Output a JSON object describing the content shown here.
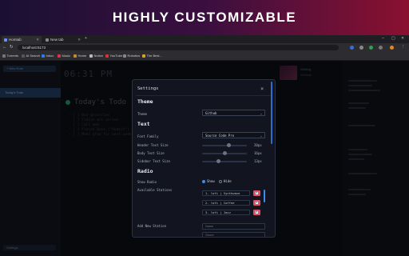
{
  "banner": {
    "title": "HIGHLY CUSTOMIZABLE"
  },
  "browser": {
    "tabs": [
      {
        "label": "Homtab",
        "active": true
      },
      {
        "label": "New tab",
        "active": false
      }
    ],
    "new_tab": "+",
    "url": "localhost:5173",
    "bookmarks": [
      "Torrents",
      "AI Search",
      "Inbox",
      "Music",
      "Home",
      "Notion",
      "YouTube",
      "Robotics",
      "The Best..."
    ]
  },
  "app": {
    "sidebar_button": "+ New Note",
    "sidebar_active_item": "Today's Todo",
    "sidebar_bottom": "Settings",
    "clock": "06:31 PM",
    "todo_title": "Today's Todo",
    "todo_items": [
      "- [ ] Buy groceries",
      "- [ ] Finish art series",
      "- [ ] Call mom",
      "- [ ] Finish Book (\"Hobbit\")",
      "- [ ] Meet prep for next week"
    ],
    "music": {
      "title": "Waiting",
      "subtitle": "Homtab"
    }
  },
  "settings": {
    "title": "Settings",
    "close": "×",
    "sections": {
      "theme": "Theme",
      "text": "Text",
      "radio": "Radio"
    },
    "theme_label": "Theme",
    "theme_value": "Github",
    "font_family_label": "Font Family",
    "font_family_value": "Source Code Pro",
    "header_size_label": "Header Text Size",
    "header_size_value": "20px",
    "body_size_label": "Body Text Size",
    "body_size_value": "16px",
    "sidebar_size_label": "Sidebar Text Size",
    "sidebar_size_value": "13px",
    "show_radio_label": "Show Radio",
    "show_option": "Show",
    "hide_option": "Hide",
    "stations_label": "Available Stations",
    "stations": [
      "1. lofi | Synthwave",
      "2. lofi | Coffee",
      "3. lofi | Jazz"
    ],
    "add_station_label": "Add New Station",
    "name_placeholder": "Name",
    "genre_placeholder": "Genre",
    "slider_levels": {
      "header": 0.6,
      "body": 0.5,
      "sidebar": 0.35
    }
  }
}
